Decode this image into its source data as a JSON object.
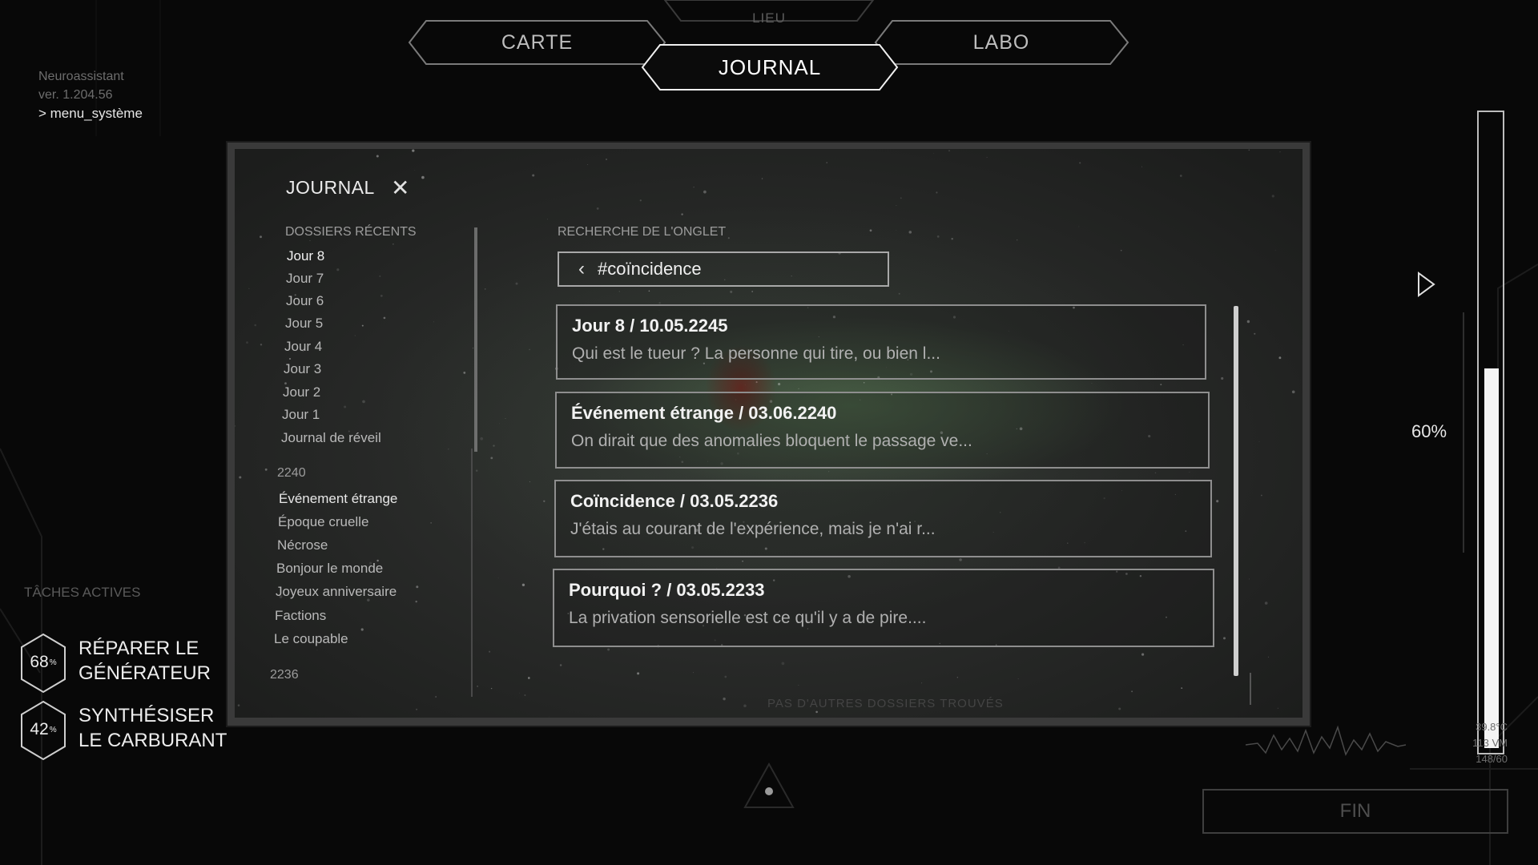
{
  "nav": {
    "lieu": "LIEU",
    "carte": "CARTE",
    "journal": "JOURNAL",
    "labo": "LABO"
  },
  "system": {
    "app_name": "Neuroassistant",
    "version": "ver. 1.204.56",
    "menu": "> menu_système"
  },
  "journal": {
    "title": "JOURNAL",
    "close_icon": "close-icon",
    "recent_heading": "DOSSIERS RÉCENTS",
    "recent_items": [
      "Jour 8",
      "Jour 7",
      "Jour 6",
      "Jour 5",
      "Jour 4",
      "Jour 3",
      "Jour 2",
      "Jour 1",
      "Journal de réveil"
    ],
    "year_2240": "2240",
    "items_2240": [
      "Événement étrange",
      "Époque cruelle",
      "Nécrose",
      "Bonjour le monde",
      "Joyeux anniversaire",
      "Factions",
      "Le coupable"
    ],
    "year_2236": "2236",
    "search_heading": "RECHERCHE DE L'ONGLET",
    "search_back": "‹",
    "search_value": "#coïncidence",
    "entries": [
      {
        "title": "Jour 8 / 10.05.2245",
        "snippet": "Qui est le tueur ? La personne qui tire, ou bien l..."
      },
      {
        "title": "Événement étrange / 03.06.2240",
        "snippet": "On dirait que des anomalies bloquent le passage ve..."
      },
      {
        "title": "Coïncidence / 03.05.2236",
        "snippet": "J'étais au courant de l'expérience, mais je n'ai r..."
      },
      {
        "title": "Pourquoi ? / 03.05.2233",
        "snippet": "La privation sensorielle est ce qu'il y a de pire...."
      }
    ],
    "footer_faded": "PAS D'AUTRES DOSSIERS TROUVÉS"
  },
  "tasks": {
    "heading": "TÂCHES ACTIVES",
    "items": [
      {
        "percent": "68",
        "unit": "%",
        "label_line1": "RÉPARER LE",
        "label_line2": "GÉNÉRATEUR"
      },
      {
        "percent": "42",
        "unit": "%",
        "label_line1": "SYNTHÉSISER",
        "label_line2": "LE CARBURANT"
      }
    ]
  },
  "meter": {
    "value": 0.6,
    "label": "60%"
  },
  "vitals": {
    "temp": "39.8°C",
    "pulse": "113 VM",
    "pressure": "148/60"
  },
  "fin_button": "FIN",
  "colors": {
    "accent": "#ffffff",
    "panel": "#2a2b2a",
    "blood": "#7a0a0a",
    "glow": "#5a7a55"
  },
  "icons": {
    "play": "play-icon",
    "close": "close-icon",
    "back": "chevron-left-icon",
    "hex": "hexagon-icon",
    "triangle": "triangle-icon"
  }
}
